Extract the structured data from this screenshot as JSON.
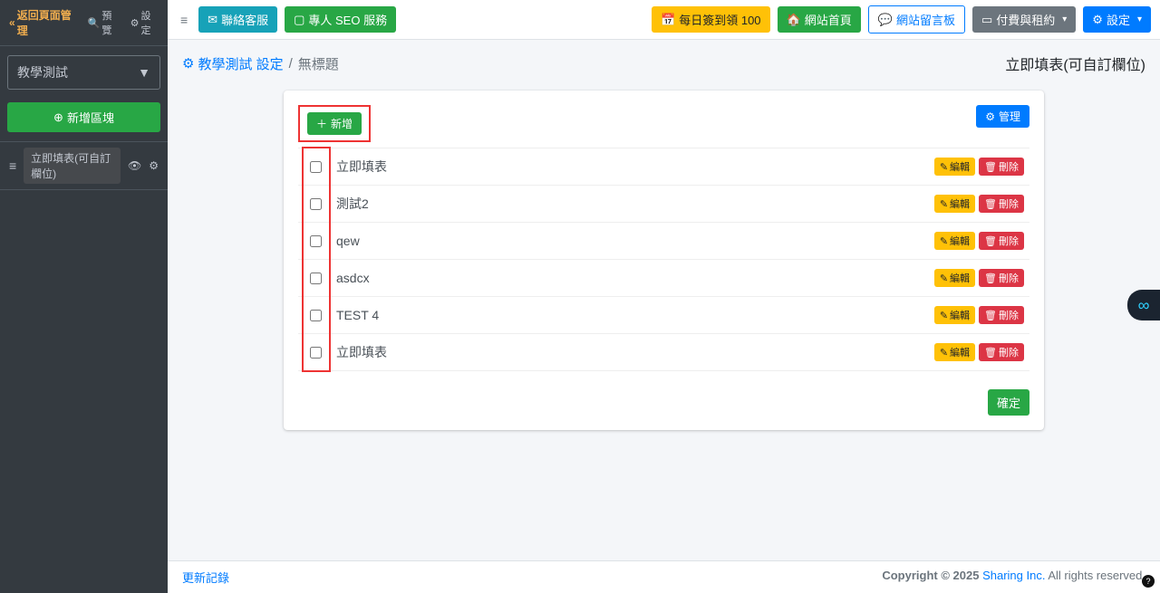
{
  "sidebar": {
    "back": "返回頁面管理",
    "preview": "預覽",
    "settings": "設定",
    "site_name": "教學測試",
    "add_block": "新增區塊",
    "item": {
      "label": "立即填表(可自訂欄位)"
    }
  },
  "topbar": {
    "contact": "聯絡客服",
    "seo": "專人 SEO 服務",
    "checkin": "每日簽到領 100",
    "home": "網站首頁",
    "guestbook": "網站留言板",
    "billing": "付費與租約",
    "settings": "設定"
  },
  "breadcrumb": {
    "root": "教學測試 設定",
    "current": "無標題"
  },
  "page_title": "立即填表(可自訂欄位)",
  "panel": {
    "add": "新增",
    "manage": "管理",
    "confirm": "確定",
    "edit": "編輯",
    "delete": "刪除",
    "rows": [
      {
        "name": "立即填表"
      },
      {
        "name": "測試2"
      },
      {
        "name": "qew"
      },
      {
        "name": "asdcx"
      },
      {
        "name": "TEST 4"
      },
      {
        "name": "立即填表"
      }
    ]
  },
  "footer": {
    "changelog": "更新記錄",
    "copyright_pre": "Copyright © 2025 ",
    "brand": "Sharing Inc.",
    "rights": " All rights reserved."
  }
}
